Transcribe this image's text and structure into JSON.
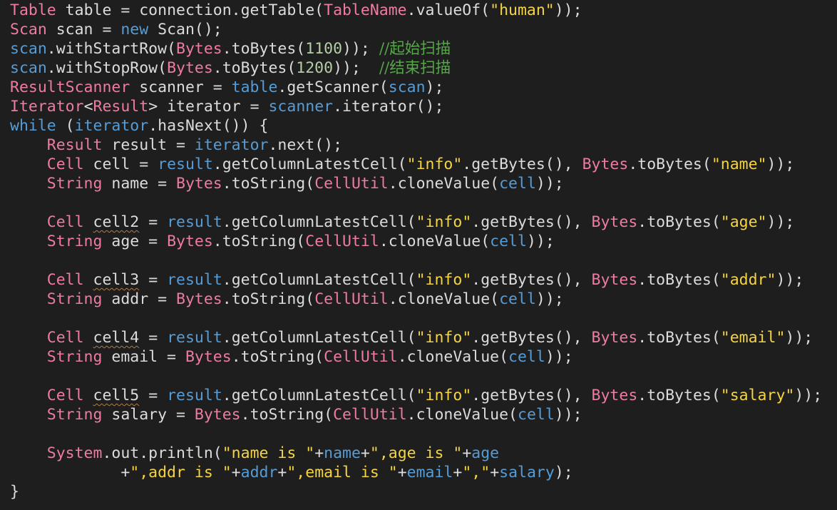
{
  "colors": {
    "background": "#1e1e1e",
    "type": "#ee7ba4",
    "local": "#dcdcdc",
    "field": "#569cd6",
    "string": "#f5d442",
    "number": "#b5cea8",
    "keyword": "#569cd6",
    "comment": "#57a64a",
    "warning_underline": "#b07d48"
  },
  "lines": [
    [
      [
        "type",
        "Table"
      ],
      [
        "local",
        " table = connection.getTable("
      ],
      [
        "type",
        "TableName"
      ],
      [
        "punct",
        ".valueOf("
      ],
      [
        "str",
        "\"human\""
      ],
      [
        "punct",
        "));"
      ]
    ],
    [
      [
        "type",
        "Scan"
      ],
      [
        "local",
        " scan = "
      ],
      [
        "kw",
        "new"
      ],
      [
        "local",
        " Scan();"
      ]
    ],
    [
      [
        "field",
        "scan"
      ],
      [
        "punct",
        ".withStartRow("
      ],
      [
        "type",
        "Bytes"
      ],
      [
        "punct",
        ".toBytes("
      ],
      [
        "num",
        "1100"
      ],
      [
        "punct",
        "));"
      ],
      [
        "punct",
        " "
      ],
      [
        "comment",
        "//起始扫描"
      ]
    ],
    [
      [
        "field",
        "scan"
      ],
      [
        "punct",
        ".withStopRow("
      ],
      [
        "type",
        "Bytes"
      ],
      [
        "punct",
        ".toBytes("
      ],
      [
        "num",
        "1200"
      ],
      [
        "punct",
        "));"
      ],
      [
        "punct",
        "  "
      ],
      [
        "comment",
        "//结束扫描"
      ]
    ],
    [
      [
        "type",
        "ResultScanner"
      ],
      [
        "local",
        " scanner = "
      ],
      [
        "field",
        "table"
      ],
      [
        "punct",
        ".getScanner("
      ],
      [
        "field",
        "scan"
      ],
      [
        "punct",
        ");"
      ]
    ],
    [
      [
        "type",
        "Iterator"
      ],
      [
        "punct",
        "<"
      ],
      [
        "type",
        "Result"
      ],
      [
        "punct",
        ">"
      ],
      [
        "local",
        " iterator = "
      ],
      [
        "field",
        "scanner"
      ],
      [
        "punct",
        ".iterator();"
      ]
    ],
    [
      [
        "kw",
        "while"
      ],
      [
        "punct",
        " ("
      ],
      [
        "field",
        "iterator"
      ],
      [
        "punct",
        ".hasNext()) {"
      ]
    ],
    [
      [
        "punct",
        "    "
      ],
      [
        "type",
        "Result"
      ],
      [
        "local",
        " result = "
      ],
      [
        "field",
        "iterator"
      ],
      [
        "punct",
        ".next();"
      ]
    ],
    [
      [
        "punct",
        "    "
      ],
      [
        "type",
        "Cell"
      ],
      [
        "local",
        " cell = "
      ],
      [
        "field",
        "result"
      ],
      [
        "punct",
        ".getColumnLatestCell("
      ],
      [
        "str",
        "\"info\""
      ],
      [
        "punct",
        ".getBytes(), "
      ],
      [
        "type",
        "Bytes"
      ],
      [
        "punct",
        ".toBytes("
      ],
      [
        "str",
        "\"name\""
      ],
      [
        "punct",
        "));"
      ]
    ],
    [
      [
        "punct",
        "    "
      ],
      [
        "type",
        "String"
      ],
      [
        "local",
        " name = "
      ],
      [
        "type",
        "Bytes"
      ],
      [
        "punct",
        ".toString("
      ],
      [
        "type",
        "CellUtil"
      ],
      [
        "punct",
        ".cloneValue("
      ],
      [
        "field",
        "cell"
      ],
      [
        "punct",
        "));"
      ]
    ],
    [],
    [
      [
        "punct",
        "    "
      ],
      [
        "type",
        "Cell"
      ],
      [
        "punct",
        " "
      ],
      [
        "warn",
        "cell2"
      ],
      [
        "local",
        " = "
      ],
      [
        "field",
        "result"
      ],
      [
        "punct",
        ".getColumnLatestCell("
      ],
      [
        "str",
        "\"info\""
      ],
      [
        "punct",
        ".getBytes(), "
      ],
      [
        "type",
        "Bytes"
      ],
      [
        "punct",
        ".toBytes("
      ],
      [
        "str",
        "\"age\""
      ],
      [
        "punct",
        "));"
      ]
    ],
    [
      [
        "punct",
        "    "
      ],
      [
        "type",
        "String"
      ],
      [
        "local",
        " age = "
      ],
      [
        "type",
        "Bytes"
      ],
      [
        "punct",
        ".toString("
      ],
      [
        "type",
        "CellUtil"
      ],
      [
        "punct",
        ".cloneValue("
      ],
      [
        "field",
        "cell"
      ],
      [
        "punct",
        "));"
      ]
    ],
    [],
    [
      [
        "punct",
        "    "
      ],
      [
        "type",
        "Cell"
      ],
      [
        "punct",
        " "
      ],
      [
        "warn",
        "cell3"
      ],
      [
        "local",
        " = "
      ],
      [
        "field",
        "result"
      ],
      [
        "punct",
        ".getColumnLatestCell("
      ],
      [
        "str",
        "\"info\""
      ],
      [
        "punct",
        ".getBytes(), "
      ],
      [
        "type",
        "Bytes"
      ],
      [
        "punct",
        ".toBytes("
      ],
      [
        "str",
        "\"addr\""
      ],
      [
        "punct",
        "));"
      ]
    ],
    [
      [
        "punct",
        "    "
      ],
      [
        "type",
        "String"
      ],
      [
        "local",
        " addr = "
      ],
      [
        "type",
        "Bytes"
      ],
      [
        "punct",
        ".toString("
      ],
      [
        "type",
        "CellUtil"
      ],
      [
        "punct",
        ".cloneValue("
      ],
      [
        "field",
        "cell"
      ],
      [
        "punct",
        "));"
      ]
    ],
    [],
    [
      [
        "punct",
        "    "
      ],
      [
        "type",
        "Cell"
      ],
      [
        "punct",
        " "
      ],
      [
        "warn",
        "cell4"
      ],
      [
        "local",
        " = "
      ],
      [
        "field",
        "result"
      ],
      [
        "punct",
        ".getColumnLatestCell("
      ],
      [
        "str",
        "\"info\""
      ],
      [
        "punct",
        ".getBytes(), "
      ],
      [
        "type",
        "Bytes"
      ],
      [
        "punct",
        ".toBytes("
      ],
      [
        "str",
        "\"email\""
      ],
      [
        "punct",
        "));"
      ]
    ],
    [
      [
        "punct",
        "    "
      ],
      [
        "type",
        "String"
      ],
      [
        "local",
        " email = "
      ],
      [
        "type",
        "Bytes"
      ],
      [
        "punct",
        ".toString("
      ],
      [
        "type",
        "CellUtil"
      ],
      [
        "punct",
        ".cloneValue("
      ],
      [
        "field",
        "cell"
      ],
      [
        "punct",
        "));"
      ]
    ],
    [],
    [
      [
        "punct",
        "    "
      ],
      [
        "type",
        "Cell"
      ],
      [
        "punct",
        " "
      ],
      [
        "warn",
        "cell5"
      ],
      [
        "local",
        " = "
      ],
      [
        "field",
        "result"
      ],
      [
        "punct",
        ".getColumnLatestCell("
      ],
      [
        "str",
        "\"info\""
      ],
      [
        "punct",
        ".getBytes(), "
      ],
      [
        "type",
        "Bytes"
      ],
      [
        "punct",
        ".toBytes("
      ],
      [
        "str",
        "\"salary\""
      ],
      [
        "punct",
        "));"
      ]
    ],
    [
      [
        "punct",
        "    "
      ],
      [
        "type",
        "String"
      ],
      [
        "local",
        " salary = "
      ],
      [
        "type",
        "Bytes"
      ],
      [
        "punct",
        ".toString("
      ],
      [
        "type",
        "CellUtil"
      ],
      [
        "punct",
        ".cloneValue("
      ],
      [
        "field",
        "cell"
      ],
      [
        "punct",
        "));"
      ]
    ],
    [],
    [
      [
        "punct",
        "    "
      ],
      [
        "type",
        "System"
      ],
      [
        "punct",
        ".out.println("
      ],
      [
        "str",
        "\"name is \""
      ],
      [
        "punct",
        "+"
      ],
      [
        "field",
        "name"
      ],
      [
        "punct",
        "+"
      ],
      [
        "str",
        "\",age is \""
      ],
      [
        "punct",
        "+"
      ],
      [
        "field",
        "age"
      ]
    ],
    [
      [
        "punct",
        "            +"
      ],
      [
        "str",
        "\",addr is \""
      ],
      [
        "punct",
        "+"
      ],
      [
        "field",
        "addr"
      ],
      [
        "punct",
        "+"
      ],
      [
        "str",
        "\",email is \""
      ],
      [
        "punct",
        "+"
      ],
      [
        "field",
        "email"
      ],
      [
        "punct",
        "+"
      ],
      [
        "str",
        "\",\""
      ],
      [
        "punct",
        "+"
      ],
      [
        "field",
        "salary"
      ],
      [
        "punct",
        ");"
      ]
    ],
    [
      [
        "punct",
        "}"
      ]
    ]
  ]
}
